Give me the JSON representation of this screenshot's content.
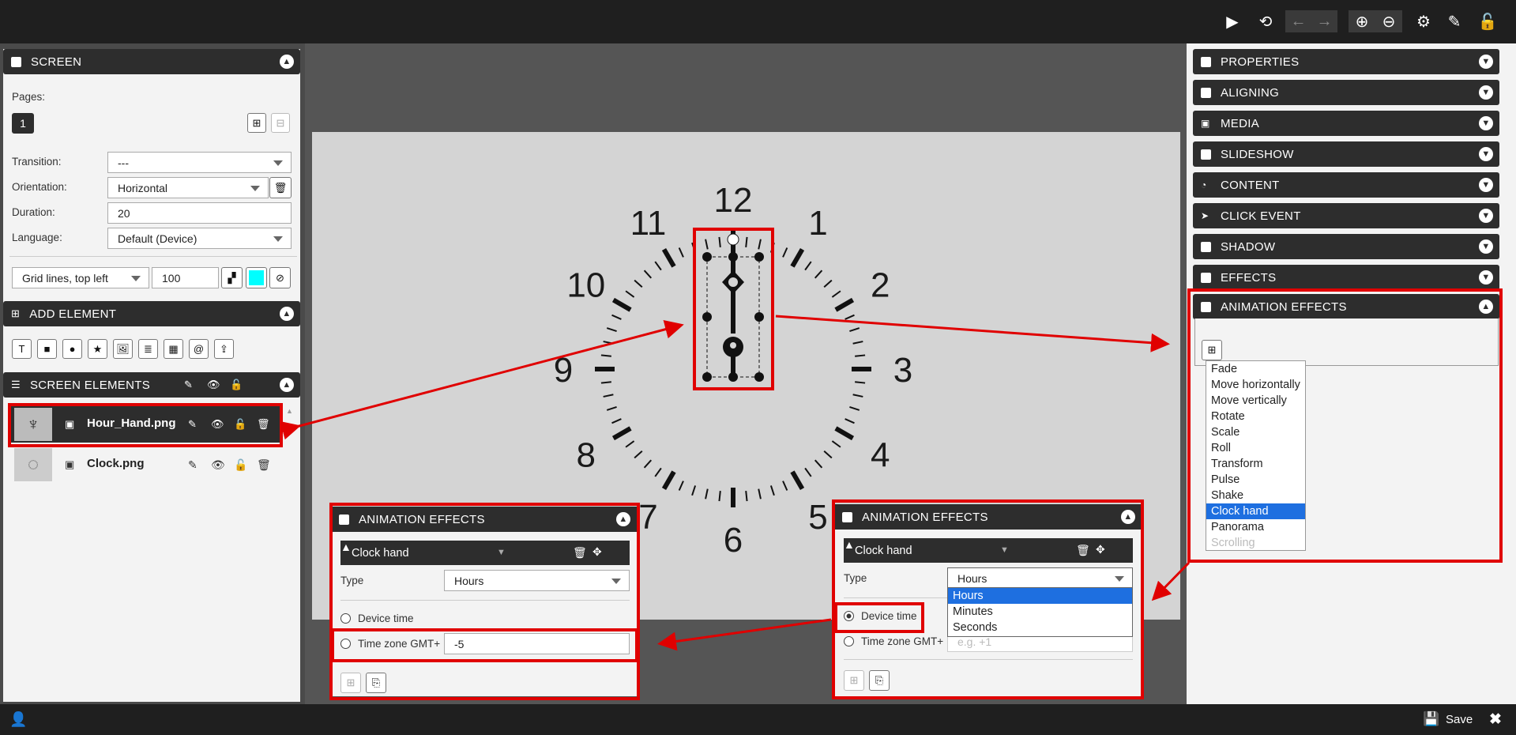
{
  "toolbar": {
    "icons": [
      "play-icon",
      "reload-icon",
      "arrow-left-icon",
      "arrow-right-icon",
      "zoom-in-icon",
      "zoom-out-icon",
      "gear-icon",
      "edit-icon",
      "lock-icon"
    ]
  },
  "screen_panel": {
    "title": "SCREEN",
    "pages_label": "Pages:",
    "page_number": "1",
    "transition_label": "Transition:",
    "transition_value": "---",
    "orientation_label": "Orientation:",
    "orientation_value": "Horizontal",
    "duration_label": "Duration:",
    "duration_value": "20",
    "language_label": "Language:",
    "language_value": "Default (Device)",
    "grid_value": "Grid lines, top left",
    "grid_size": "100",
    "grid_color": "#00ffff"
  },
  "add_element": {
    "title": "ADD ELEMENT",
    "tools": [
      "T",
      "■",
      "●",
      "★",
      "🖼",
      "≣",
      "▦",
      "@",
      "⇪"
    ]
  },
  "screen_elements": {
    "title": "SCREEN ELEMENTS",
    "items": [
      {
        "name": "Hour_Hand.png"
      },
      {
        "name": "Clock.png"
      }
    ]
  },
  "clock_numbers": [
    "12",
    "1",
    "2",
    "3",
    "4",
    "5",
    "6",
    "7",
    "8",
    "9",
    "10",
    "11"
  ],
  "right_panel": {
    "sections": [
      "PROPERTIES",
      "ALIGNING",
      "MEDIA",
      "SLIDESHOW",
      "CONTENT",
      "CLICK EVENT",
      "SHADOW",
      "EFFECTS",
      "ANIMATION EFFECTS"
    ],
    "effect_menu": [
      "Fade",
      "Move horizontally",
      "Move vertically",
      "Rotate",
      "Scale",
      "Roll",
      "Transform",
      "Pulse",
      "Shake",
      "Clock hand",
      "Panorama",
      "Scrolling"
    ],
    "effect_selected": "Clock hand"
  },
  "anim_left": {
    "title": "ANIMATION EFFECTS",
    "effect": "Clock hand",
    "type_label": "Type",
    "type_value": "Hours",
    "device_time_label": "Device time",
    "timezone_label": "Time zone GMT+",
    "timezone_value": "-5"
  },
  "anim_right": {
    "title": "ANIMATION EFFECTS",
    "effect": "Clock hand",
    "type_label": "Type",
    "type_value": "Hours",
    "type_options": [
      "Hours",
      "Minutes",
      "Seconds"
    ],
    "device_time_label": "Device time",
    "timezone_label": "Time zone GMT+",
    "timezone_placeholder": "e.g. +1"
  },
  "bottom": {
    "save_label": "Save"
  },
  "colors": {
    "highlight": "#e00000",
    "accent": "#1e6fe0"
  }
}
